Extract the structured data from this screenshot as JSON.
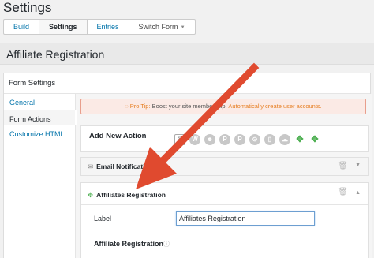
{
  "page": {
    "title": "Settings"
  },
  "tabs": [
    {
      "label": "Build",
      "active": false
    },
    {
      "label": "Settings",
      "active": true
    },
    {
      "label": "Entries",
      "active": false
    },
    {
      "label": "Switch Form",
      "active": false
    }
  ],
  "form": {
    "title": "Affiliate Registration"
  },
  "settings": {
    "heading": "Form Settings",
    "nav": [
      "General",
      "Form Actions",
      "Customize HTML"
    ],
    "pro_tip": {
      "label": "Pro Tip:",
      "text": "Boost your site membership.",
      "link": "Automatically create user accounts."
    },
    "add_action": {
      "title": "Add New Action",
      "icons": [
        "email-icon",
        "wordpress-icon",
        "user-icon",
        "paypal-icon",
        "paypal-icon",
        "twilio-icon",
        "mobile-icon",
        "cloud-download-icon",
        "affiliate-icon",
        "affiliate-icon"
      ]
    },
    "email_notification": {
      "title": "Email Notification"
    },
    "affiliates_registration": {
      "title": "Affiliates Registration",
      "label_field_label": "Label",
      "label_field_value": "Affiliates Registration",
      "section_label": "Affiliate Registration"
    }
  },
  "colors": {
    "accent": "#0073aa",
    "arrow": "#e04a2f",
    "tip": "#e67e22",
    "affiliate": "#4caf50"
  }
}
